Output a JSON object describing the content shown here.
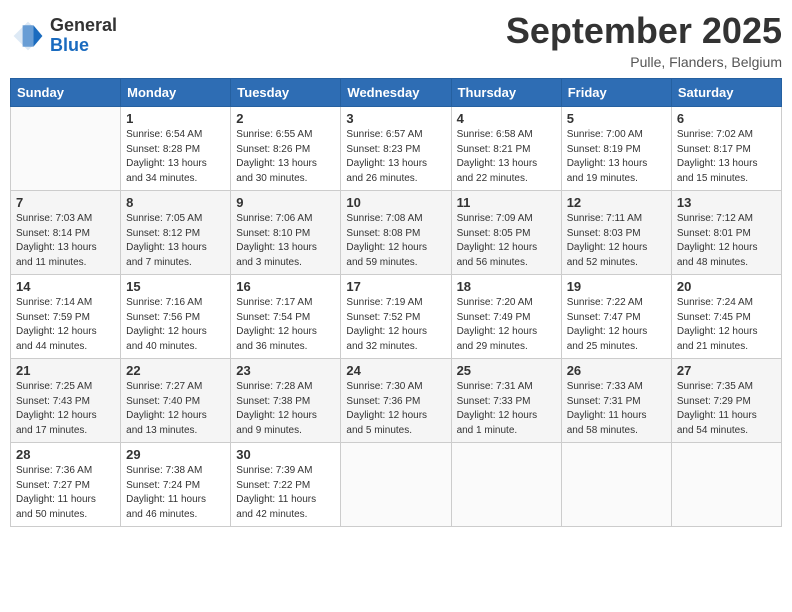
{
  "header": {
    "logo_general": "General",
    "logo_blue": "Blue",
    "month_title": "September 2025",
    "location": "Pulle, Flanders, Belgium"
  },
  "days_of_week": [
    "Sunday",
    "Monday",
    "Tuesday",
    "Wednesday",
    "Thursday",
    "Friday",
    "Saturday"
  ],
  "weeks": [
    [
      {
        "day": "",
        "info": ""
      },
      {
        "day": "1",
        "info": "Sunrise: 6:54 AM\nSunset: 8:28 PM\nDaylight: 13 hours\nand 34 minutes."
      },
      {
        "day": "2",
        "info": "Sunrise: 6:55 AM\nSunset: 8:26 PM\nDaylight: 13 hours\nand 30 minutes."
      },
      {
        "day": "3",
        "info": "Sunrise: 6:57 AM\nSunset: 8:23 PM\nDaylight: 13 hours\nand 26 minutes."
      },
      {
        "day": "4",
        "info": "Sunrise: 6:58 AM\nSunset: 8:21 PM\nDaylight: 13 hours\nand 22 minutes."
      },
      {
        "day": "5",
        "info": "Sunrise: 7:00 AM\nSunset: 8:19 PM\nDaylight: 13 hours\nand 19 minutes."
      },
      {
        "day": "6",
        "info": "Sunrise: 7:02 AM\nSunset: 8:17 PM\nDaylight: 13 hours\nand 15 minutes."
      }
    ],
    [
      {
        "day": "7",
        "info": "Sunrise: 7:03 AM\nSunset: 8:14 PM\nDaylight: 13 hours\nand 11 minutes."
      },
      {
        "day": "8",
        "info": "Sunrise: 7:05 AM\nSunset: 8:12 PM\nDaylight: 13 hours\nand 7 minutes."
      },
      {
        "day": "9",
        "info": "Sunrise: 7:06 AM\nSunset: 8:10 PM\nDaylight: 13 hours\nand 3 minutes."
      },
      {
        "day": "10",
        "info": "Sunrise: 7:08 AM\nSunset: 8:08 PM\nDaylight: 12 hours\nand 59 minutes."
      },
      {
        "day": "11",
        "info": "Sunrise: 7:09 AM\nSunset: 8:05 PM\nDaylight: 12 hours\nand 56 minutes."
      },
      {
        "day": "12",
        "info": "Sunrise: 7:11 AM\nSunset: 8:03 PM\nDaylight: 12 hours\nand 52 minutes."
      },
      {
        "day": "13",
        "info": "Sunrise: 7:12 AM\nSunset: 8:01 PM\nDaylight: 12 hours\nand 48 minutes."
      }
    ],
    [
      {
        "day": "14",
        "info": "Sunrise: 7:14 AM\nSunset: 7:59 PM\nDaylight: 12 hours\nand 44 minutes."
      },
      {
        "day": "15",
        "info": "Sunrise: 7:16 AM\nSunset: 7:56 PM\nDaylight: 12 hours\nand 40 minutes."
      },
      {
        "day": "16",
        "info": "Sunrise: 7:17 AM\nSunset: 7:54 PM\nDaylight: 12 hours\nand 36 minutes."
      },
      {
        "day": "17",
        "info": "Sunrise: 7:19 AM\nSunset: 7:52 PM\nDaylight: 12 hours\nand 32 minutes."
      },
      {
        "day": "18",
        "info": "Sunrise: 7:20 AM\nSunset: 7:49 PM\nDaylight: 12 hours\nand 29 minutes."
      },
      {
        "day": "19",
        "info": "Sunrise: 7:22 AM\nSunset: 7:47 PM\nDaylight: 12 hours\nand 25 minutes."
      },
      {
        "day": "20",
        "info": "Sunrise: 7:24 AM\nSunset: 7:45 PM\nDaylight: 12 hours\nand 21 minutes."
      }
    ],
    [
      {
        "day": "21",
        "info": "Sunrise: 7:25 AM\nSunset: 7:43 PM\nDaylight: 12 hours\nand 17 minutes."
      },
      {
        "day": "22",
        "info": "Sunrise: 7:27 AM\nSunset: 7:40 PM\nDaylight: 12 hours\nand 13 minutes."
      },
      {
        "day": "23",
        "info": "Sunrise: 7:28 AM\nSunset: 7:38 PM\nDaylight: 12 hours\nand 9 minutes."
      },
      {
        "day": "24",
        "info": "Sunrise: 7:30 AM\nSunset: 7:36 PM\nDaylight: 12 hours\nand 5 minutes."
      },
      {
        "day": "25",
        "info": "Sunrise: 7:31 AM\nSunset: 7:33 PM\nDaylight: 12 hours\nand 1 minute."
      },
      {
        "day": "26",
        "info": "Sunrise: 7:33 AM\nSunset: 7:31 PM\nDaylight: 11 hours\nand 58 minutes."
      },
      {
        "day": "27",
        "info": "Sunrise: 7:35 AM\nSunset: 7:29 PM\nDaylight: 11 hours\nand 54 minutes."
      }
    ],
    [
      {
        "day": "28",
        "info": "Sunrise: 7:36 AM\nSunset: 7:27 PM\nDaylight: 11 hours\nand 50 minutes."
      },
      {
        "day": "29",
        "info": "Sunrise: 7:38 AM\nSunset: 7:24 PM\nDaylight: 11 hours\nand 46 minutes."
      },
      {
        "day": "30",
        "info": "Sunrise: 7:39 AM\nSunset: 7:22 PM\nDaylight: 11 hours\nand 42 minutes."
      },
      {
        "day": "",
        "info": ""
      },
      {
        "day": "",
        "info": ""
      },
      {
        "day": "",
        "info": ""
      },
      {
        "day": "",
        "info": ""
      }
    ]
  ]
}
